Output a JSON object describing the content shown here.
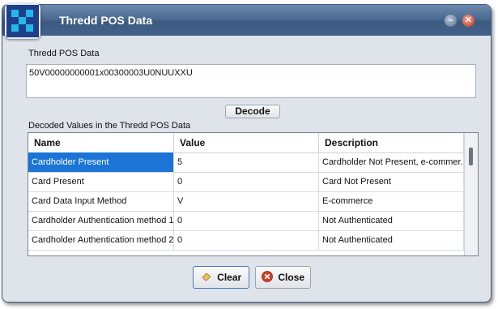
{
  "window": {
    "title": "Thredd POS Data"
  },
  "pos_data": {
    "label": "Thredd POS Data",
    "value": "50V00000000001x00300003U0NUUXXU"
  },
  "decode_button": "Decode",
  "decoded": {
    "label": "Decoded Values in the Thredd POS Data",
    "columns": [
      "Name",
      "Value",
      "Description"
    ],
    "rows": [
      {
        "name": "Cardholder Present",
        "value": "5",
        "description": "Cardholder Not Present, e-commer..."
      },
      {
        "name": "Card Present",
        "value": "0",
        "description": "Card Not Present"
      },
      {
        "name": "Card Data Input Method",
        "value": "V",
        "description": "E-commerce"
      },
      {
        "name": "Cardholder Authentication method 1",
        "value": "0",
        "description": "Not Authenticated"
      },
      {
        "name": "Cardholder Authentication method 2",
        "value": "0",
        "description": "Not Authenticated"
      }
    ]
  },
  "actions": {
    "clear": "Clear",
    "close": "Close"
  }
}
